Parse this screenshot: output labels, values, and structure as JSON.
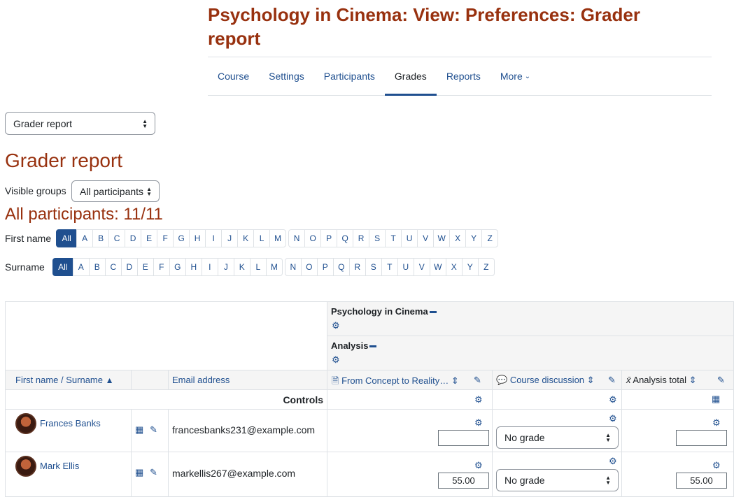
{
  "page_title": "Psychology in Cinema: View: Preferences: Grader report",
  "nav": {
    "items": [
      "Course",
      "Settings",
      "Participants",
      "Grades",
      "Reports"
    ],
    "more_label": "More",
    "active": "Grades"
  },
  "report_selector": {
    "value": "Grader report"
  },
  "heading": "Grader report",
  "visible_groups": {
    "label": "Visible groups",
    "value": "All participants"
  },
  "participants_heading": "All participants: 11/11",
  "initials": {
    "firstname_label": "First name",
    "surname_label": "Surname",
    "all_label": "All",
    "letters_a_m": [
      "A",
      "B",
      "C",
      "D",
      "E",
      "F",
      "G",
      "H",
      "I",
      "J",
      "K",
      "L",
      "M"
    ],
    "letters_n_z": [
      "N",
      "O",
      "P",
      "Q",
      "R",
      "S",
      "T",
      "U",
      "V",
      "W",
      "X",
      "Y",
      "Z"
    ]
  },
  "grader": {
    "course_category": "Psychology in Cinema",
    "sub_category": "Analysis",
    "columns": {
      "name": "First name / Surname",
      "email": "Email address",
      "item1": "From Concept to Reality…",
      "item2": "Course discussion",
      "item3": "Analysis total"
    },
    "controls_label": "Controls",
    "rows": [
      {
        "name": "Frances Banks",
        "email": "francesbanks231@example.com",
        "grade1": "",
        "grade2": "No grade",
        "grade3": ""
      },
      {
        "name": "Mark Ellis",
        "email": "markellis267@example.com",
        "grade1": "55.00",
        "grade2": "No grade",
        "grade3": "55.00"
      }
    ]
  },
  "colors": {
    "accent": "#1f4f8f",
    "heading": "#98310f"
  }
}
